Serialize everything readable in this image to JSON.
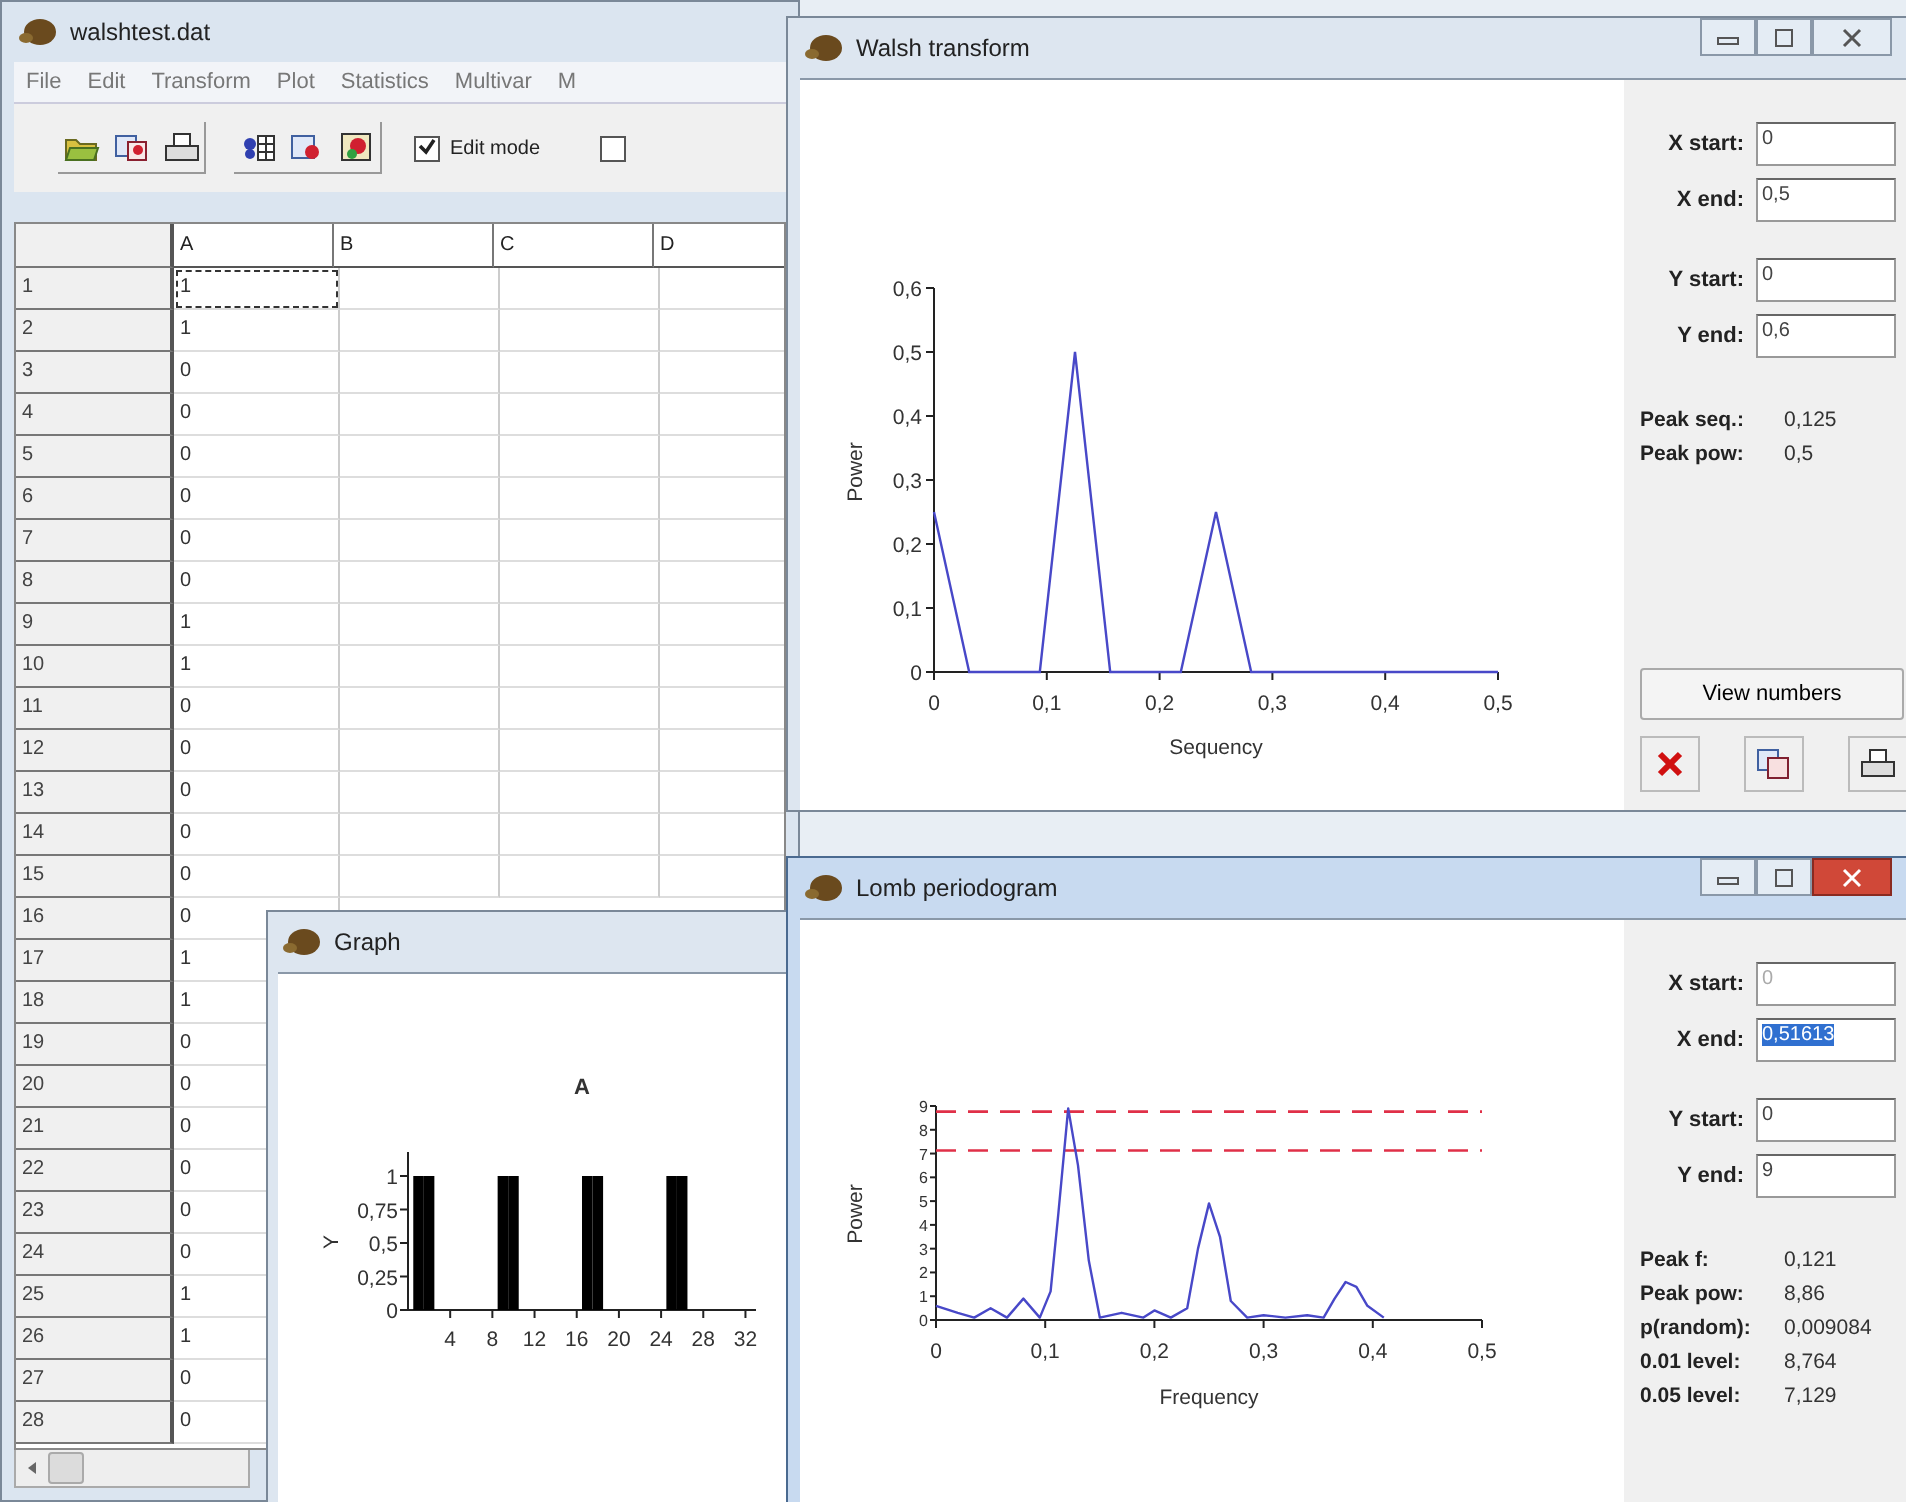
{
  "main_window": {
    "title": "walshtest.dat",
    "menu": [
      "File",
      "Edit",
      "Transform",
      "Plot",
      "Statistics",
      "Multivar",
      "M"
    ],
    "checkboxes": [
      {
        "label": "Edit mode",
        "checked": true
      },
      {
        "checked": false
      }
    ],
    "grid": {
      "columns": [
        "A",
        "B",
        "C",
        "D"
      ],
      "rows": [
        {
          "label": "1",
          "value": "1",
          "selected": true
        },
        {
          "label": "2",
          "value": "1",
          "selected": false
        },
        {
          "label": "3",
          "value": "0",
          "selected": false
        },
        {
          "label": "4",
          "value": "0",
          "selected": false
        },
        {
          "label": "5",
          "value": "0",
          "selected": false
        },
        {
          "label": "6",
          "value": "0",
          "selected": false
        },
        {
          "label": "7",
          "value": "0",
          "selected": false
        },
        {
          "label": "8",
          "value": "0",
          "selected": false
        },
        {
          "label": "9",
          "value": "1",
          "selected": false
        },
        {
          "label": "10",
          "value": "1",
          "selected": false
        },
        {
          "label": "11",
          "value": "0",
          "selected": false
        },
        {
          "label": "12",
          "value": "0",
          "selected": false
        },
        {
          "label": "13",
          "value": "0",
          "selected": false
        },
        {
          "label": "14",
          "value": "0",
          "selected": false
        },
        {
          "label": "15",
          "value": "0",
          "selected": false
        },
        {
          "label": "16",
          "value": "0",
          "selected": false
        },
        {
          "label": "17",
          "value": "1",
          "selected": false
        },
        {
          "label": "18",
          "value": "1",
          "selected": false
        },
        {
          "label": "19",
          "value": "0",
          "selected": false
        },
        {
          "label": "20",
          "value": "0",
          "selected": false
        },
        {
          "label": "21",
          "value": "0",
          "selected": false
        },
        {
          "label": "22",
          "value": "0",
          "selected": false
        },
        {
          "label": "23",
          "value": "0",
          "selected": false
        },
        {
          "label": "24",
          "value": "0",
          "selected": false
        },
        {
          "label": "25",
          "value": "1",
          "selected": false
        },
        {
          "label": "26",
          "value": "1",
          "selected": false
        },
        {
          "label": "27",
          "value": "0",
          "selected": false
        },
        {
          "label": "28",
          "value": "0",
          "selected": false
        }
      ]
    }
  },
  "walsh_window": {
    "title": "Walsh transform",
    "active": false,
    "chart_data": {
      "type": "line",
      "xlabel": "Sequency",
      "ylabel": "Power",
      "x": [
        0,
        0.03125,
        0.0625,
        0.09375,
        0.125,
        0.15625,
        0.1875,
        0.21875,
        0.25,
        0.28125,
        0.3125,
        0.34375,
        0.375,
        0.40625,
        0.4375,
        0.46875,
        0.5
      ],
      "series": [
        {
          "color": "#4848c8",
          "values": [
            0.25,
            0,
            0,
            0,
            0.5,
            0,
            0,
            0,
            0.25,
            0,
            0,
            0,
            0,
            0,
            0,
            0,
            0
          ]
        }
      ],
      "xlim": [
        0,
        0.5
      ],
      "ylim": [
        0,
        0.6
      ],
      "xticks": [
        {
          "value": 0,
          "label": "0"
        },
        {
          "value": 0.1,
          "label": "0,1"
        },
        {
          "value": 0.2,
          "label": "0,2"
        },
        {
          "value": 0.3,
          "label": "0,3"
        },
        {
          "value": 0.4,
          "label": "0,4"
        },
        {
          "value": 0.5,
          "label": "0,5"
        }
      ],
      "yticks": [
        {
          "value": 0,
          "label": "0"
        },
        {
          "value": 0.1,
          "label": "0,1"
        },
        {
          "value": 0.2,
          "label": "0,2"
        },
        {
          "value": 0.3,
          "label": "0,3"
        },
        {
          "value": 0.4,
          "label": "0,4"
        },
        {
          "value": 0.5,
          "label": "0,5"
        },
        {
          "value": 0.6,
          "label": "0,6"
        }
      ]
    },
    "fields": [
      {
        "label": "X start:",
        "value": "0",
        "disabled": false,
        "highlighted": false
      },
      {
        "label": "X end:",
        "value": "0,5",
        "disabled": false,
        "highlighted": false
      },
      {
        "label": "Y start:",
        "value": "0",
        "disabled": false,
        "highlighted": false
      },
      {
        "label": "Y end:",
        "value": "0,6",
        "disabled": false,
        "highlighted": false
      }
    ],
    "stats": [
      {
        "label": "Peak seq.:",
        "value": "0,125"
      },
      {
        "label": "Peak pow:",
        "value": "0,5"
      }
    ],
    "button": "View numbers"
  },
  "graph_window": {
    "title": "Graph",
    "active": false,
    "chart_data": {
      "type": "bar",
      "title": "A",
      "ylabel": "Y",
      "x": [
        1,
        2,
        3,
        4,
        5,
        6,
        7,
        8,
        9,
        10,
        11,
        12,
        13,
        14,
        15,
        16,
        17,
        18,
        19,
        20,
        21,
        22,
        23,
        24,
        25,
        26,
        27,
        28,
        29,
        30,
        31,
        32
      ],
      "series": [
        {
          "color": "#000000",
          "values": [
            1,
            1,
            0,
            0,
            0,
            0,
            0,
            0,
            1,
            1,
            0,
            0,
            0,
            0,
            0,
            0,
            1,
            1,
            0,
            0,
            0,
            0,
            0,
            0,
            1,
            1,
            0,
            0,
            0,
            0,
            0,
            0
          ]
        }
      ],
      "xlim": [
        0,
        33
      ],
      "ylim": [
        0,
        1
      ],
      "xticks": [
        4,
        8,
        12,
        16,
        20,
        24,
        28,
        32
      ],
      "yticks": [
        {
          "value": 0,
          "label": "0"
        },
        {
          "value": 0.25,
          "label": "0,25"
        },
        {
          "value": 0.5,
          "label": "0,5"
        },
        {
          "value": 0.75,
          "label": "0,75"
        },
        {
          "value": 1,
          "label": "1"
        }
      ]
    }
  },
  "lomb_window": {
    "title": "Lomb periodogram",
    "active": true,
    "chart_data": {
      "type": "line",
      "xlabel": "Frequency",
      "ylabel": "Power",
      "x": [
        0,
        0.02,
        0.035,
        0.05,
        0.065,
        0.08,
        0.095,
        0.105,
        0.112,
        0.121,
        0.13,
        0.14,
        0.15,
        0.17,
        0.19,
        0.2,
        0.215,
        0.23,
        0.24,
        0.25,
        0.26,
        0.27,
        0.285,
        0.3,
        0.32,
        0.34,
        0.355,
        0.365,
        0.375,
        0.385,
        0.395,
        0.41
      ],
      "series": [
        {
          "color": "#4848c8",
          "values": [
            0.6,
            0.3,
            0.1,
            0.5,
            0.1,
            0.9,
            0.1,
            1.2,
            4.5,
            8.9,
            6.5,
            2.5,
            0.1,
            0.3,
            0.1,
            0.4,
            0.1,
            0.5,
            3,
            4.9,
            3.5,
            0.8,
            0.1,
            0.2,
            0.1,
            0.2,
            0.1,
            0.9,
            1.6,
            1.4,
            0.6,
            0.1
          ]
        }
      ],
      "xlim": [
        0,
        0.5
      ],
      "ylim": [
        0,
        9
      ],
      "xticks": [
        {
          "value": 0,
          "label": "0"
        },
        {
          "value": 0.1,
          "label": "0,1"
        },
        {
          "value": 0.2,
          "label": "0,2"
        },
        {
          "value": 0.3,
          "label": "0,3"
        },
        {
          "value": 0.4,
          "label": "0,4"
        },
        {
          "value": 0.5,
          "label": "0,5"
        }
      ],
      "yticks": [
        0,
        1,
        2,
        3,
        4,
        5,
        6,
        7,
        8,
        9
      ],
      "ref_lines": [
        {
          "axis": "y",
          "value": 8.764,
          "color": "#e03048"
        },
        {
          "axis": "y",
          "value": 7.129,
          "color": "#e03048"
        }
      ]
    },
    "fields": [
      {
        "label": "X start:",
        "value": "0",
        "disabled": true,
        "highlighted": false
      },
      {
        "label": "X end:",
        "value": "0,51613",
        "disabled": false,
        "highlighted": true
      },
      {
        "label": "Y start:",
        "value": "0",
        "disabled": false,
        "highlighted": false
      },
      {
        "label": "Y end:",
        "value": "9",
        "disabled": false,
        "highlighted": false
      }
    ],
    "stats": [
      {
        "label": "Peak f:",
        "value": "0,121"
      },
      {
        "label": "Peak pow:",
        "value": "8,86"
      },
      {
        "label": "p(random):",
        "value": "0,009084"
      },
      {
        "label": "0.01 level:",
        "value": "8,764"
      },
      {
        "label": "0.05 level:",
        "value": "7,129"
      }
    ]
  }
}
